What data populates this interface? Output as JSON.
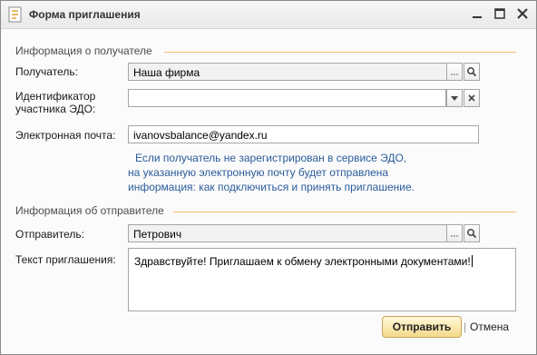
{
  "window": {
    "title": "Форма приглашения"
  },
  "recipient_section": {
    "title": "Информация о получателе",
    "recipient_label": "Получатель:",
    "recipient_value": "Наша фирма",
    "edo_id_label_line1": "Идентификатор",
    "edo_id_label_line2": "участника ЭДО:",
    "edo_id_value": "",
    "email_label": "Электронная почта:",
    "email_value": "ivanovsbalance@yandex.ru",
    "info_line1": "Если получатель не зарегистрирован в сервисе ЭДО,",
    "info_line2": "на указанную электронную почту будет отправлена",
    "info_line3": "информация: как подключиться и принять приглашение."
  },
  "sender_section": {
    "title": "Информация об отправителе",
    "sender_label": "Отправитель:",
    "sender_value": "Петрович",
    "invite_text_label": "Текст приглашения:",
    "invite_text_value": "Здравствуйте! Приглашаем к обмену электронными документами!"
  },
  "actions": {
    "send_label": "Отправить",
    "separator": "|",
    "cancel_label": "Отмена"
  },
  "colors": {
    "section_line": "#f0c070",
    "info_text": "#2a5b9a",
    "send_button": "#f4d98a"
  }
}
